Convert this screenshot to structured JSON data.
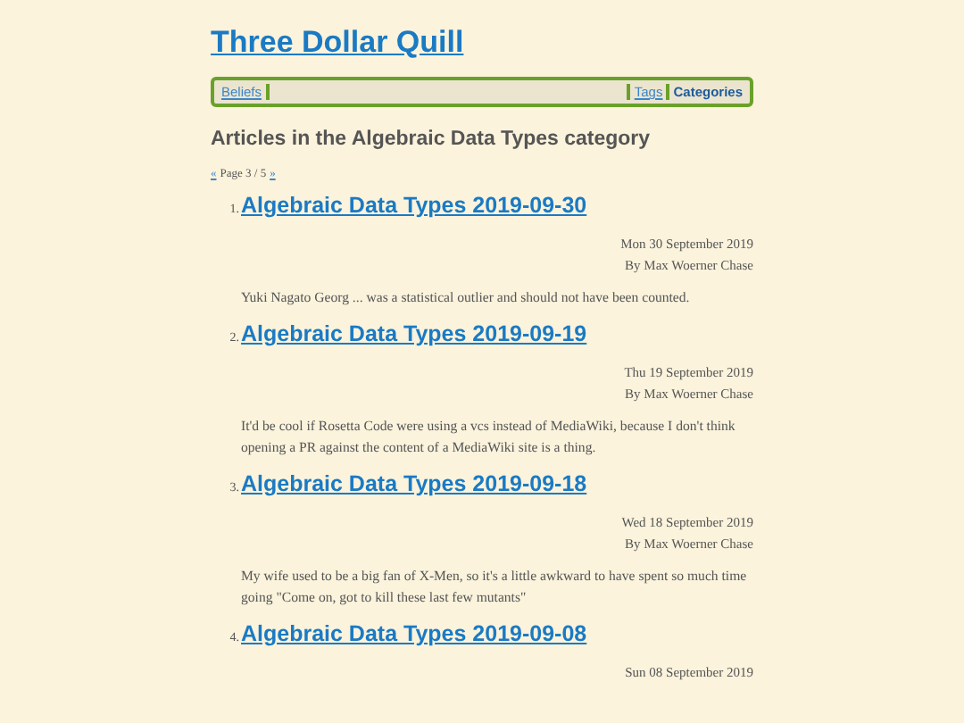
{
  "site_title": "Three Dollar Quill",
  "nav": {
    "left": [
      {
        "label": "Beliefs",
        "selected": false
      }
    ],
    "right": [
      {
        "label": "Tags",
        "selected": false
      },
      {
        "label": "Categories",
        "selected": true
      }
    ]
  },
  "heading": "Articles in the Algebraic Data Types category",
  "pagination": {
    "prev": "«",
    "text": "Page 3 / 5",
    "next": "»"
  },
  "articles": [
    {
      "number": "1.",
      "title": "Algebraic Data Types 2019-09-30",
      "date": "Mon 30 September 2019",
      "author": "By Max Woerner Chase",
      "summary": "Yuki Nagato Georg ... was a statistical outlier and should not have been counted."
    },
    {
      "number": "2.",
      "title": "Algebraic Data Types 2019-09-19",
      "date": "Thu 19 September 2019",
      "author": "By Max Woerner Chase",
      "summary": "It'd be cool if Rosetta Code were using a vcs instead of MediaWiki, because I don't think opening a PR against the content of a MediaWiki site is a thing."
    },
    {
      "number": "3.",
      "title": "Algebraic Data Types 2019-09-18",
      "date": "Wed 18 September 2019",
      "author": "By Max Woerner Chase",
      "summary": "My wife used to be a big fan of X-Men, so it's a little awkward to have spent so much time going \"Come on, got to kill these last few mutants\""
    },
    {
      "number": "4.",
      "title": "Algebraic Data Types 2019-09-08",
      "date": "Sun 08 September 2019"
    }
  ]
}
